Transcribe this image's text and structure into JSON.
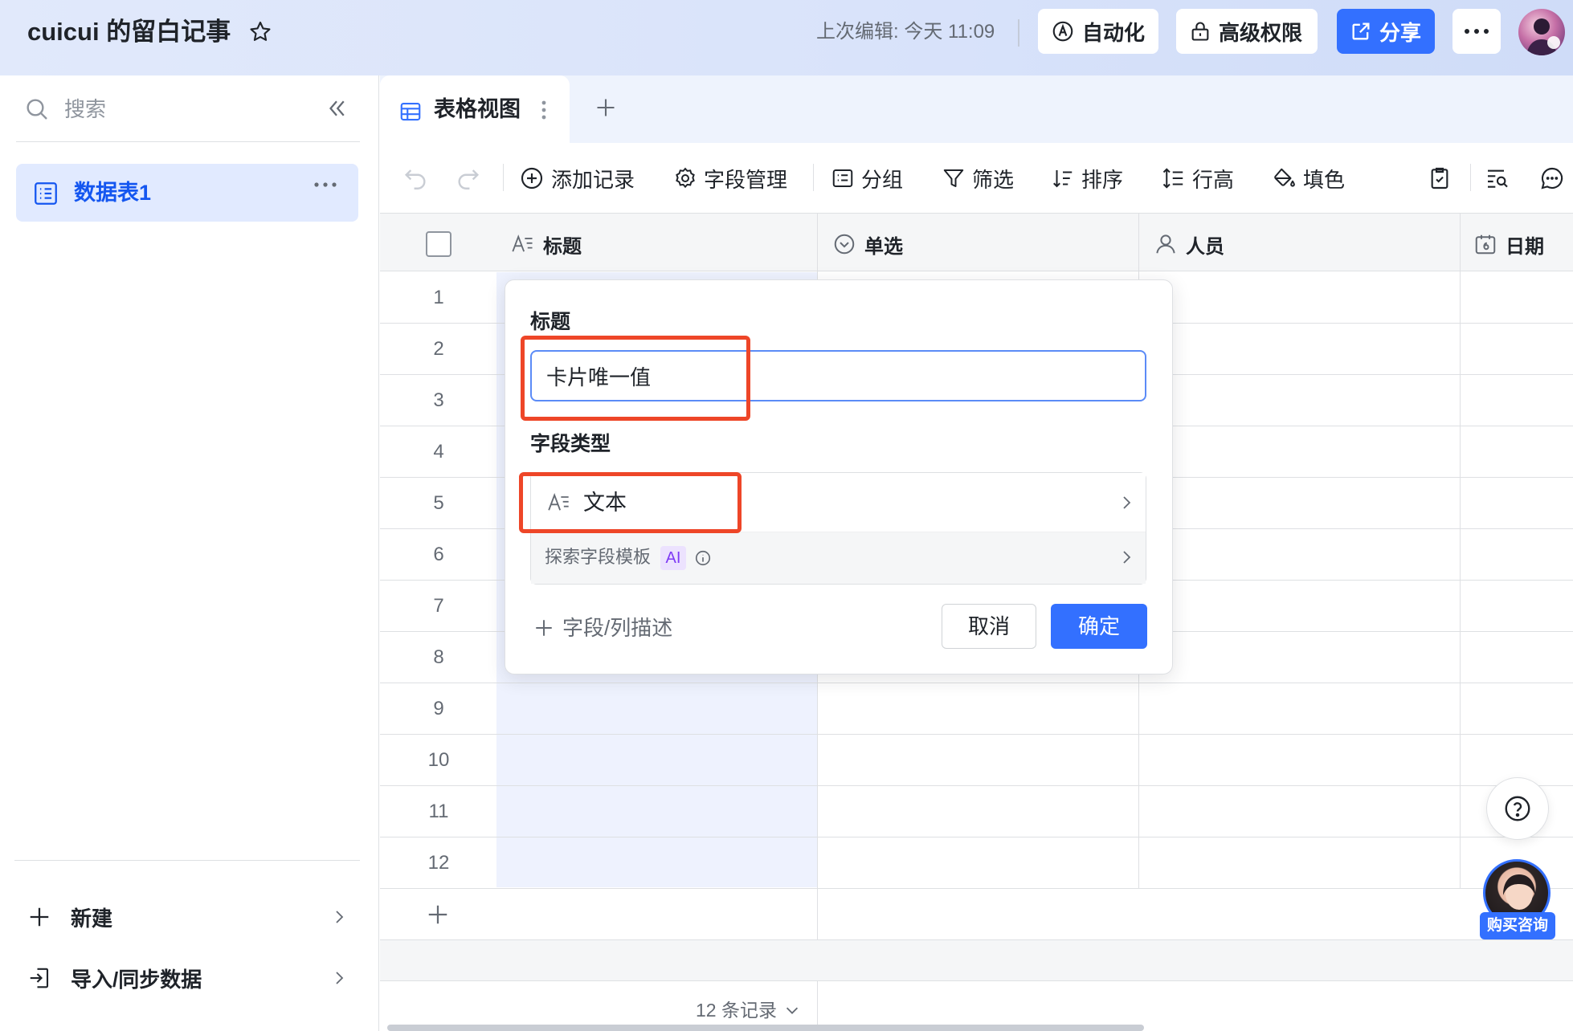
{
  "header": {
    "doc_title": "cuicui 的留白记事",
    "last_edit": "上次编辑: 今天 11:09",
    "automation_label": "自动化",
    "permissions_label": "高级权限",
    "share_label": "分享"
  },
  "sidebar": {
    "search_placeholder": "搜索",
    "table_item_label": "数据表1",
    "new_label": "新建",
    "import_label": "导入/同步数据"
  },
  "view_tabs": {
    "active_tab_label": "表格视图"
  },
  "toolbar": {
    "add_record": "添加记录",
    "field_manage": "字段管理",
    "group": "分组",
    "filter": "筛选",
    "sort": "排序",
    "row_height": "行高",
    "fill_color": "填色"
  },
  "grid": {
    "columns": [
      "标题",
      "单选",
      "人员",
      "日期"
    ],
    "row_numbers": [
      "1",
      "2",
      "3",
      "4",
      "5",
      "6",
      "7",
      "8",
      "9",
      "10",
      "11",
      "12"
    ],
    "footer_records": "12 条记录"
  },
  "field_dialog": {
    "title_label": "标题",
    "field_name_value": "卡片唯一值",
    "field_type_label": "字段类型",
    "field_type_value": "文本",
    "template_label": "探索字段模板",
    "ai_badge": "AI",
    "add_description": "字段/列描述",
    "cancel_label": "取消",
    "confirm_label": "确定"
  },
  "floating": {
    "consult_label": "购买咨询"
  },
  "colors": {
    "primary": "#3370ff",
    "annotation_red": "#ee4628",
    "selected_bg": "#e1eaff"
  }
}
